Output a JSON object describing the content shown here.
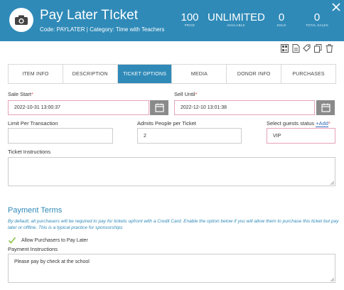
{
  "header": {
    "title": "Pay Later TIcket",
    "subtitle": "Code: PAYLATER | Category: Time with Teachers",
    "stats": [
      {
        "value": "100",
        "label": "PRICE"
      },
      {
        "value": "UNLIMITED",
        "label": "AVAILABLE"
      },
      {
        "value": "0",
        "label": "SOLD"
      },
      {
        "value": "0",
        "label": "TOTAL SALES"
      }
    ]
  },
  "tabs": [
    "ITEM INFO",
    "DESCRIPTION",
    "TICKET OPTIONS",
    "MEDIA",
    "DONOR INFO",
    "PURCHASES"
  ],
  "active_tab": "TICKET OPTIONS",
  "form": {
    "sale_start_label": "Sale Start",
    "sale_start_value": "2022-10-31 13:00:37",
    "sell_until_label": "Sell Until",
    "sell_until_value": "2022-12-10 13:01:38",
    "limit_label": "Limit Per Transaction",
    "limit_value": "",
    "admits_label": "Admits People per Ticket",
    "admits_value": "2",
    "guest_status_label": "Select guests status",
    "add_link": "+Add",
    "guest_status_value": "VIP",
    "instructions_label": "Ticket Instructions",
    "instructions_value": "",
    "required_mark": "*"
  },
  "payment_terms": {
    "title": "Payment Terms",
    "help": "By default, all purchasers will be required to pay for tickets upfront with a Credit Card. Enable the option below if you will allow them to purchase this ticket but pay later or offline. This is a typical practice for sponsorships",
    "allow_label": "Allow Purchasers to Pay Later",
    "allow_checked": true,
    "instructions_label": "Payment Instructions",
    "instructions_value": "Please pay by check at the school"
  },
  "colors": {
    "header": "#2f8ab8",
    "active_tab": "#2f8ab8",
    "required": "#d9534f",
    "check": "#8bc34a"
  },
  "icons": {
    "logo": "camera-icon",
    "close": "close-icon",
    "toolbar": [
      "qr-code-icon",
      "document-icon",
      "tag-icon",
      "copy-icon",
      "trash-icon"
    ],
    "calendar": "calendar-icon",
    "checkbox": "checkmark-icon"
  }
}
